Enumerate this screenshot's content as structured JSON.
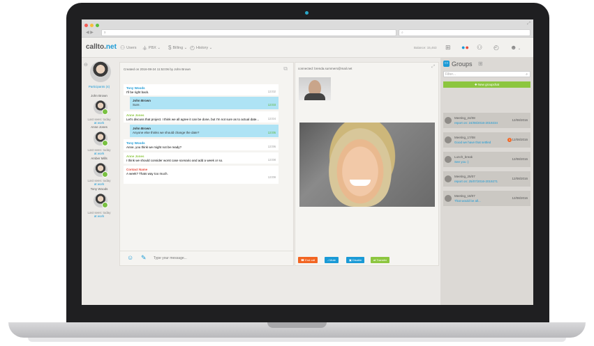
{
  "browser": {
    "address": "x",
    "nav_back": "◀",
    "nav_forward": "▶"
  },
  "app": {
    "logo_prefix": "callto.",
    "logo_brand": "net",
    "nav": {
      "users": "Users",
      "pbx": "PBX",
      "billing": "Billing",
      "history": "History"
    },
    "balance": "Balance: 15,463"
  },
  "participants": {
    "header": "Participants (4)",
    "list": [
      {
        "name": "John Brown",
        "last_seen": "Last seen: today",
        "status": "at work"
      },
      {
        "name": "Anne Jones",
        "last_seen": "Last seen: today",
        "status": "at work"
      },
      {
        "name": "Amber Mills",
        "last_seen": "Last seen: today",
        "status": "at work"
      },
      {
        "name": "Tony Woods",
        "last_seen": "Last seen: today",
        "status": "at work"
      }
    ]
  },
  "chat": {
    "created": "Created on 2016-08-24 11:53:06 by John Brown",
    "input_placeholder": "Type your message...",
    "messages": [
      {
        "who": "Tony Woods",
        "text": "I'll be right back.",
        "time": "13:02",
        "color": "#1a9ad6"
      },
      {
        "reply_who": "John Brown",
        "reply_text": "Sure.",
        "reply_time": "13:03"
      },
      {
        "who": "Anne Jones",
        "text": "Let's discuss that project. I think we all agree it can be done, but I'm not sure as to actual date...",
        "time": "13:04",
        "color": "#8cc63f"
      },
      {
        "reply_who": "John Brown",
        "reply_text": "Anyone else thinks we should change the date?",
        "reply_time": "13:05"
      },
      {
        "who": "Tony Woods",
        "text": "Anne, you think we might not be ready?",
        "time": "13:06",
        "color": "#1a9ad6"
      },
      {
        "who": "Anne Jones",
        "text": "I think we should consider worst case scenario and add a week or so.",
        "time": "13:08",
        "color": "#8cc63f"
      },
      {
        "who": "Contact Name",
        "text": "A week? Thats way too much.",
        "time": "13:09",
        "color": "#e84a3b"
      }
    ]
  },
  "video": {
    "connected": "connected: brenda.summers@mail.net",
    "buttons": {
      "end_call": "End call",
      "mute": "Mute",
      "disable": "Disable",
      "transfer": "Transfer"
    }
  },
  "groups": {
    "title": "Groups",
    "filter_placeholder": "Filter...",
    "new_group_chat": "New groupchat",
    "items": [
      {
        "name": "Meeting_24/08",
        "sub": "report on: 24/08/2016-2019234",
        "date": "12/08/2016"
      },
      {
        "name": "Meeting_17/08",
        "sub": "Good we have that settled",
        "date": "12/08/2016",
        "badge": "1"
      },
      {
        "name": "Lunch_break",
        "sub": "See you :)",
        "date": "12/08/2016"
      },
      {
        "name": "Meeting_25/07",
        "sub": "report on: 25/07/2016-2019271",
        "date": "12/08/2016"
      },
      {
        "name": "Meeting_18/07",
        "sub": "That would be all...",
        "date": "12/08/2016"
      }
    ]
  }
}
